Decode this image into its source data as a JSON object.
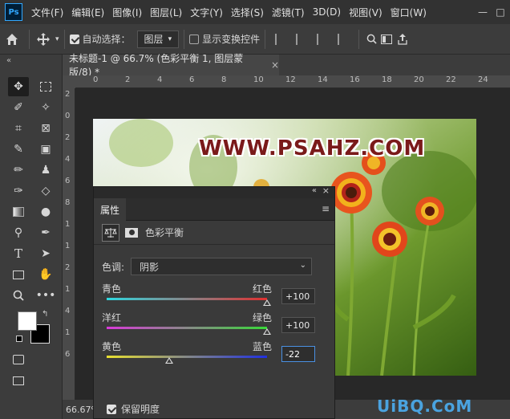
{
  "app": {
    "logo": "Ps"
  },
  "menu": [
    "文件(F)",
    "编辑(E)",
    "图像(I)",
    "图层(L)",
    "文字(Y)",
    "选择(S)",
    "滤镜(T)",
    "3D(D)",
    "视图(V)",
    "窗口(W)"
  ],
  "window_controls": {
    "minimize": "—",
    "restore": "□"
  },
  "options_bar": {
    "auto_select_label": "自动选择：",
    "auto_select_checked": true,
    "target_value": "图层",
    "show_transform_label": "显示变换控件",
    "show_transform_checked": false
  },
  "document_tab": {
    "title": "未标题-1 @ 66.7% (色彩平衡 1, 图层蒙版/8) *",
    "close": "×"
  },
  "ruler_h": [
    "0",
    "2",
    "4",
    "6",
    "8",
    "10",
    "12",
    "14",
    "16",
    "18",
    "20",
    "22",
    "24"
  ],
  "ruler_v": [
    "2",
    "0",
    "2",
    "4",
    "6",
    "8",
    "1",
    "1",
    "2",
    "1",
    "4",
    "1",
    "6"
  ],
  "canvas": {
    "watermark_text": "WWW.PSAHZ.COM"
  },
  "status": {
    "zoom": "66.67%"
  },
  "properties": {
    "tab_label": "属性",
    "collapse": "«",
    "close": "×",
    "menu_icon": "≡",
    "adjustment_title": "色彩平衡",
    "tone_label": "色调:",
    "tone_value": "阴影",
    "sliders": [
      {
        "left": "青色",
        "right": "红色",
        "value": "+100",
        "fraction": 1.0
      },
      {
        "left": "洋红",
        "right": "绿色",
        "value": "+100",
        "fraction": 1.0
      },
      {
        "left": "黄色",
        "right": "蓝色",
        "value": "-22",
        "fraction": 0.39
      }
    ],
    "preserve_label": "保留明度",
    "preserve_checked": true
  },
  "site_watermark": "UiBQ.CoM",
  "colors": {
    "accent": "#31a8ff",
    "focus": "#4a90e2"
  }
}
